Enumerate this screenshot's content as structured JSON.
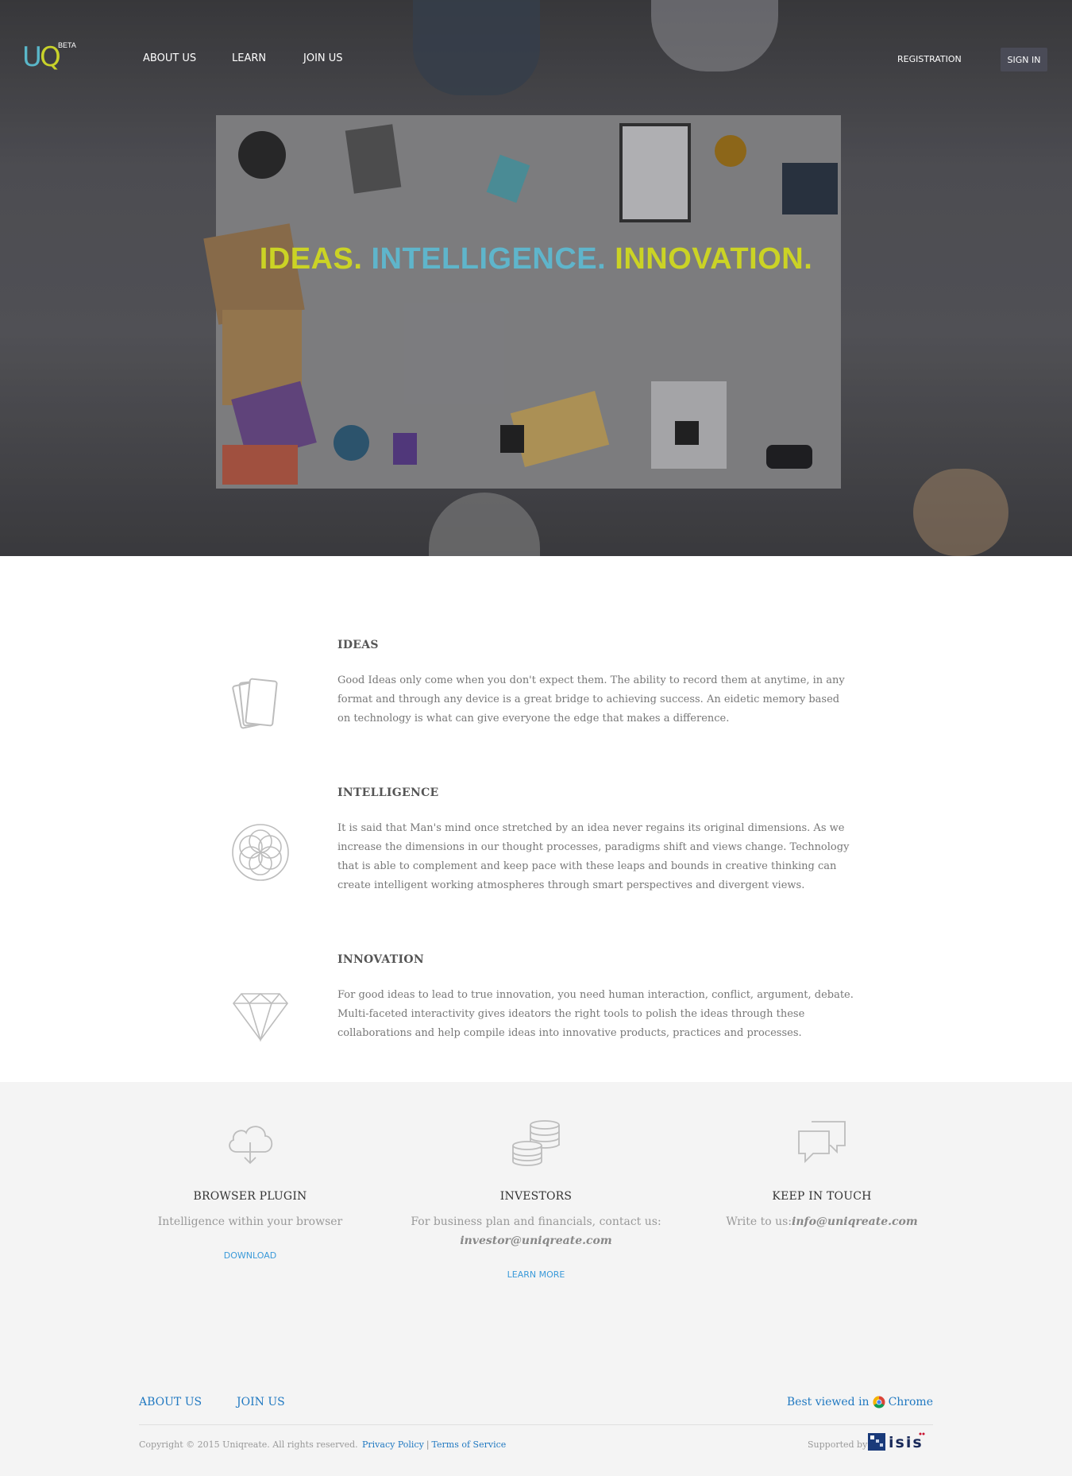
{
  "header": {
    "logo": {
      "u": "U",
      "q": "Q",
      "beta": "BETA"
    },
    "nav": [
      "ABOUT US",
      "LEARN",
      "JOIN US"
    ],
    "registration": "REGISTRATION",
    "sign_in": "SIGN IN"
  },
  "hero": {
    "part1": "IDEAS.",
    "part2": "INTELLIGENCE.",
    "part3": "INNOVATION."
  },
  "features": [
    {
      "icon": "cards-icon",
      "title": "IDEAS",
      "text": "Good Ideas only come when you don't expect them. The ability to record them at anytime, in any format and through any device is a great bridge to achieving success. An eidetic memory based on technology is what can give everyone the edge that makes a difference."
    },
    {
      "icon": "flower-of-life-icon",
      "title": "INTELLIGENCE",
      "text": "It is said that Man's mind once stretched by an idea never regains its original dimensions. As we increase the dimensions in our thought processes, paradigms shift and views change. Technology that is able to complement and keep pace with these leaps and bounds in creative thinking can create intelligent working atmospheres through smart perspectives and divergent views."
    },
    {
      "icon": "diamond-icon",
      "title": "INNOVATION",
      "text": "For good ideas to lead to true innovation, you need human interaction, conflict, argument, debate. Multi-faceted interactivity gives ideators the right tools to polish the ideas through these collaborations and help compile ideas into innovative products, practices and processes."
    }
  ],
  "columns": {
    "plugin": {
      "icon": "cloud-download-icon",
      "title": "BROWSER PLUGIN",
      "text": "Intelligence within your browser",
      "link": "DOWNLOAD"
    },
    "investors": {
      "icon": "coins-icon",
      "title": "INVESTORS",
      "text": "For business plan and financials, contact us:",
      "email": "investor@uniqreate.com",
      "link": "LEARN MORE"
    },
    "contact": {
      "icon": "chat-bubbles-icon",
      "title": "KEEP IN TOUCH",
      "text": "Write to us:",
      "email": "info@uniqreate.com"
    }
  },
  "footer": {
    "links": [
      "ABOUT US",
      "JOIN US"
    ],
    "best_viewed": "Best viewed in",
    "browser": "Chrome",
    "copyright": "Copyright © 2015 Uniqreate. All rights reserved.",
    "privacy": "Privacy Policy",
    "separator": "|",
    "terms": "Terms of Service",
    "supported_by": "Supported by",
    "sponsor_logo": "isis"
  },
  "colors": {
    "brand_yellow": "#cbd325",
    "brand_blue": "#5fb5cb",
    "link_blue": "#1f78c1",
    "signin_bg": "#4a4b57"
  }
}
